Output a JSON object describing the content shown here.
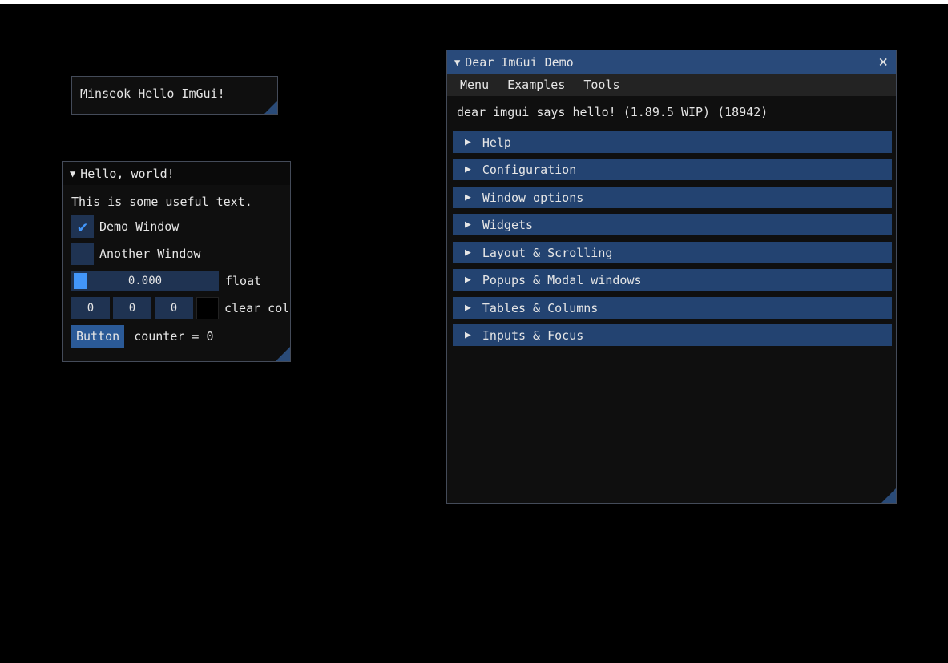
{
  "overlay": {
    "text": "Minseok Hello ImGui!"
  },
  "hello_window": {
    "title": "Hello, world!",
    "useful_text": "This is some useful text.",
    "demo_checkbox": {
      "label": "Demo Window",
      "checked": true,
      "check_glyph": "✔"
    },
    "another_checkbox": {
      "label": "Another Window",
      "checked": false
    },
    "slider": {
      "value": "0.000",
      "label": "float",
      "fill": 0.0
    },
    "color": {
      "r": "0",
      "g": "0",
      "b": "0",
      "label": "clear color",
      "swatch": "#000000"
    },
    "button_label": "Button",
    "counter_text": "counter = 0"
  },
  "demo_window": {
    "title": "Dear ImGui Demo",
    "close_glyph": "✕",
    "menus": [
      "Menu",
      "Examples",
      "Tools"
    ],
    "hello_line": "dear imgui says hello! (1.89.5 WIP) (18942)",
    "headers": [
      "Help",
      "Configuration",
      "Window options",
      "Widgets",
      "Layout & Scrolling",
      "Popups & Modal windows",
      "Tables & Columns",
      "Inputs & Focus"
    ]
  },
  "glyphs": {
    "collapse": "▼",
    "expand": "▶"
  },
  "colors": {
    "title_active": "#294a7a",
    "header": "#234371",
    "frame": "#1f3352",
    "check": "#4296fa",
    "button": "#2b5a97",
    "window_bg": "#0f0f0f"
  }
}
